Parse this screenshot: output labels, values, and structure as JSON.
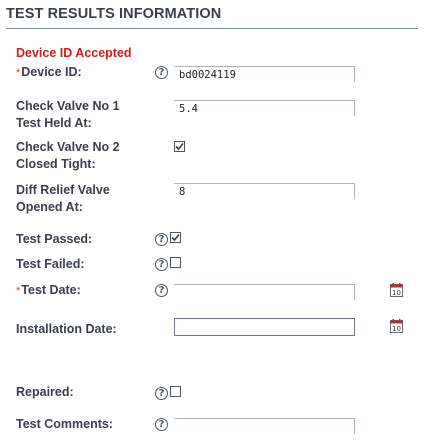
{
  "section": {
    "title": "TEST RESULTS INFORMATION"
  },
  "status": {
    "device_accepted": "Device ID Accepted"
  },
  "fields": {
    "device_id": {
      "required_marker": "*",
      "label": "Device ID:",
      "value": "bd0024119"
    },
    "check_valve_1": {
      "label_line1": "Check Valve No 1",
      "label_line2": "Test Held At:",
      "value": "5.4"
    },
    "check_valve_2": {
      "label_line1": "Check Valve No 2",
      "label_line2": "Closed Tight:",
      "checked": true
    },
    "diff_relief": {
      "label_line1": "Diff Relief Valve",
      "label_line2": "Opened At:",
      "value": "8"
    },
    "test_passed": {
      "label": "Test Passed:",
      "checked": true
    },
    "test_failed": {
      "label": "Test Failed:",
      "checked": false
    },
    "test_date": {
      "required_marker": "*",
      "label": "Test Date:",
      "value": ""
    },
    "installation_date": {
      "label": "Installation Date:",
      "value": ""
    },
    "repaired": {
      "label": "Repaired:",
      "checked": false
    },
    "test_comments": {
      "label": "Test Comments:",
      "value": ""
    }
  },
  "icons": {
    "help": "help-circle-icon",
    "calendar": "calendar-icon",
    "check": "checkmark-icon"
  },
  "colors": {
    "accepted_text": "#cc1f1f",
    "required_marker": "#d23b3b",
    "calendar_accent": "#b03030"
  }
}
